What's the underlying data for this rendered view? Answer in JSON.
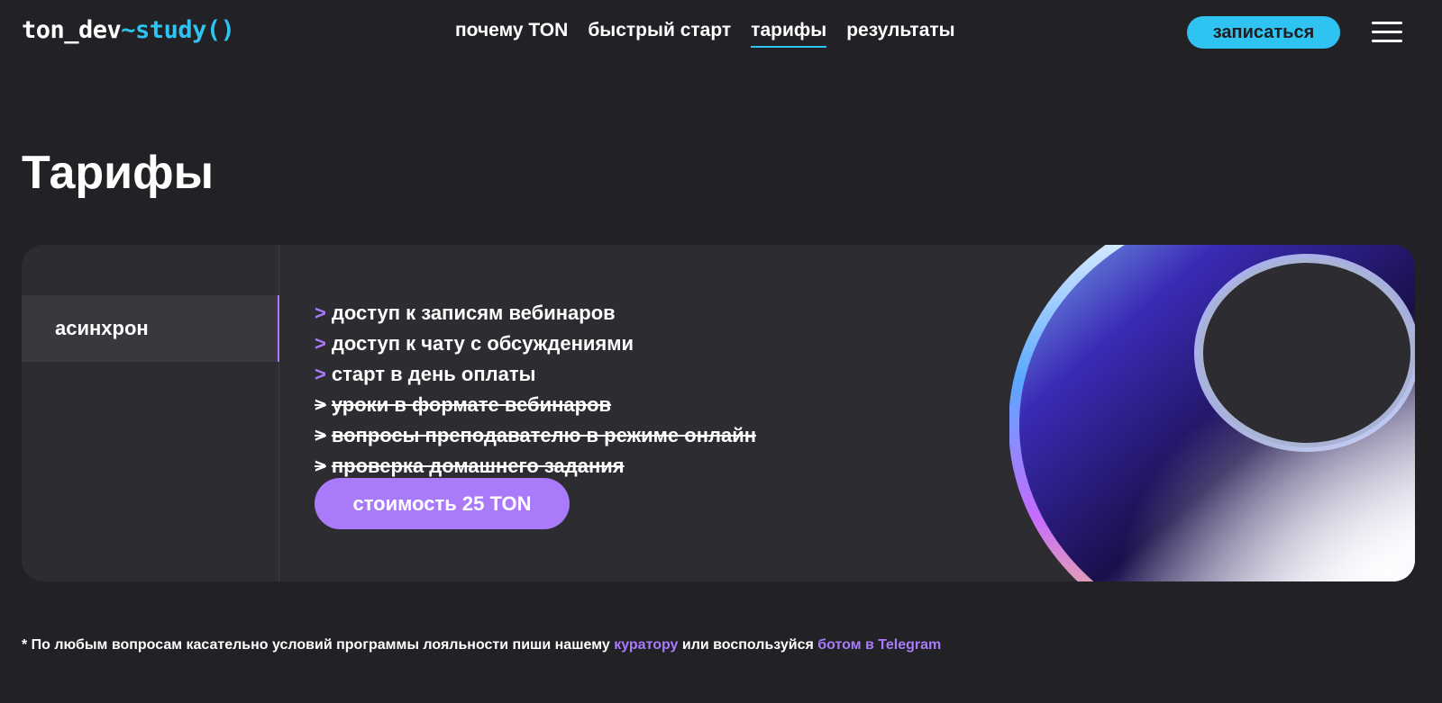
{
  "header": {
    "logo_main": "ton_dev",
    "logo_accent": "~study()",
    "nav": [
      "почему TON",
      "быстрый старт",
      "тарифы",
      "результаты"
    ],
    "active_nav": "тарифы",
    "signup_label": "записаться",
    "menu_icon": "hamburger-icon"
  },
  "page_title": "Тарифы",
  "tariff": {
    "tab_label": "асинхрон",
    "bullet": ">",
    "features": [
      {
        "text": "доступ к записям вебинаров",
        "included": true
      },
      {
        "text": "доступ к чату с обсуждениями",
        "included": true
      },
      {
        "text": "старт в день оплаты",
        "included": true
      },
      {
        "text": "уроки в формате вебинаров",
        "included": false
      },
      {
        "text": "вопросы преподавателю в режиме онлайн",
        "included": false
      },
      {
        "text": "проверка домашнего задания",
        "included": false
      }
    ],
    "price_label": "стоимость 25 TON"
  },
  "footnote": {
    "text_1": "* По любым вопросам касательно условий программы лояльности пиши нашему ",
    "link_1": "куратору",
    "text_2": " или воспользуйся ",
    "link_2": "ботом в Telegram"
  },
  "colors": {
    "background": "#222226",
    "card": "#2c2c31",
    "accent_cyan": "#2ec3f0",
    "accent_purple": "#a97bfb"
  }
}
